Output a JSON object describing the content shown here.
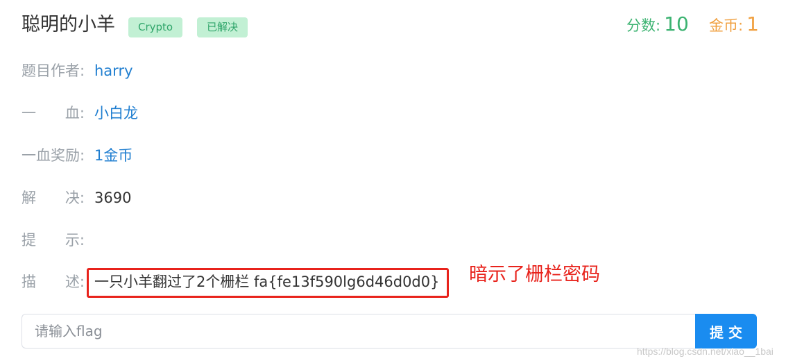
{
  "header": {
    "title": "聪明的小羊",
    "tags": [
      "Crypto",
      "已解决"
    ],
    "score_label": "分数:",
    "score_value": "10",
    "coins_label": "金币:",
    "coins_value": "1"
  },
  "info": {
    "author_label": "题目作者:",
    "author_value": "harry",
    "blood_label_chars": [
      "一",
      "血:"
    ],
    "blood_value": "小白龙",
    "reward_label": "一血奖励:",
    "reward_value": "1金币",
    "solved_label_chars": [
      "解",
      "决:"
    ],
    "solved_value": "3690",
    "hint_label_chars": [
      "提",
      "示:"
    ],
    "hint_value": "",
    "desc_label_chars": [
      "描",
      "述:"
    ],
    "desc_value": "一只小羊翻过了2个栅栏 fa{fe13f590lg6d46d0d0}"
  },
  "annotation": "暗示了栅栏密码",
  "flag_form": {
    "placeholder": "请输入flag",
    "submit_label": "提 交"
  },
  "watermark": "https://blog.csdn.net/xiao__1bai",
  "colors": {
    "accent_blue": "#1a8cf0",
    "link_blue": "#1f7ed0",
    "score_green": "#3cb371",
    "coin_orange": "#f0a040",
    "tag_bg": "#c2f0d4",
    "tag_text": "#2fa56a",
    "annotation_red": "#e8231c"
  }
}
